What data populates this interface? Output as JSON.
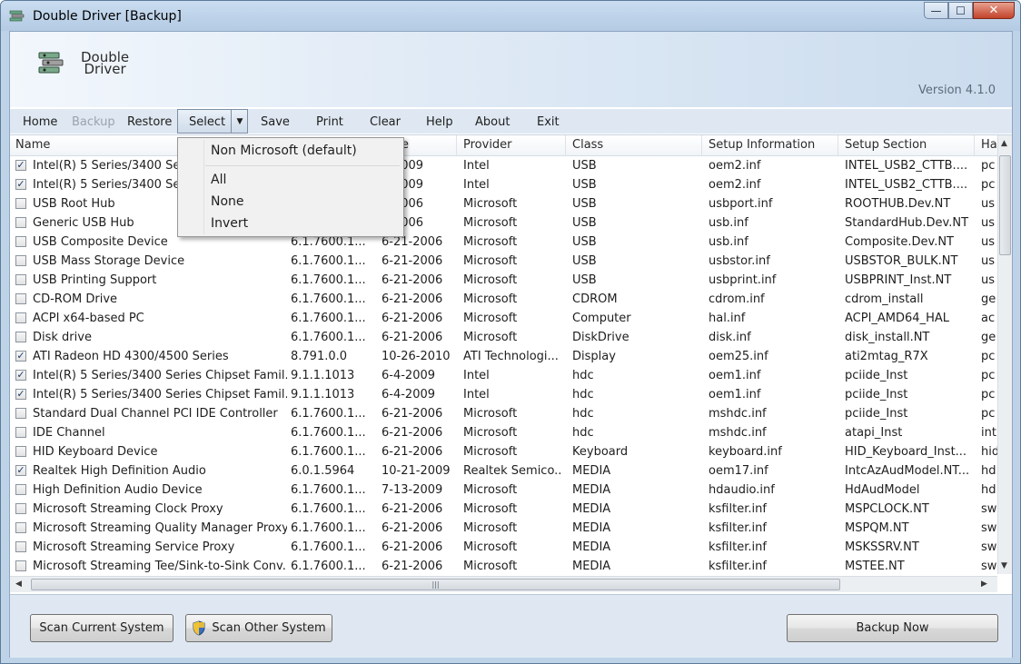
{
  "window": {
    "title": "Double Driver [Backup]",
    "minimize": "—",
    "maximize": "☐",
    "close": "✕"
  },
  "banner": {
    "logo_line1": "Double",
    "logo_line2": "Driver",
    "version": "Version 4.1.0"
  },
  "menu": {
    "home": "Home",
    "backup": "Backup",
    "restore": "Restore",
    "select": "Select",
    "save": "Save",
    "print": "Print",
    "clear": "Clear",
    "help": "Help",
    "about": "About",
    "exit": "Exit"
  },
  "select_dropdown": [
    "Non Microsoft (default)",
    "All",
    "None",
    "Invert"
  ],
  "columns": [
    "Name",
    "e",
    "Provider",
    "Class",
    "Setup Information",
    "Setup Section",
    "Ha"
  ],
  "rows": [
    {
      "checked": true,
      "name": "Intel(R) 5 Series/3400 Seri",
      "version": "",
      "date": "0-2009",
      "provider": "Intel",
      "class": "USB",
      "inf": "oem2.inf",
      "section": "INTEL_USB2_CTTB....",
      "hw": "pc"
    },
    {
      "checked": true,
      "name": "Intel(R) 5 Series/3400 Seri",
      "version": "",
      "date": "0-2009",
      "provider": "Intel",
      "class": "USB",
      "inf": "oem2.inf",
      "section": "INTEL_USB2_CTTB....",
      "hw": "pc"
    },
    {
      "checked": false,
      "name": "USB Root Hub",
      "version": "",
      "date": "1-2006",
      "provider": "Microsoft",
      "class": "USB",
      "inf": "usbport.inf",
      "section": "ROOTHUB.Dev.NT",
      "hw": "us"
    },
    {
      "checked": false,
      "name": "Generic USB Hub",
      "version": "",
      "date": "1-2006",
      "provider": "Microsoft",
      "class": "USB",
      "inf": "usb.inf",
      "section": "StandardHub.Dev.NT",
      "hw": "us"
    },
    {
      "checked": false,
      "name": "USB Composite Device",
      "version": "6.1.7600.1...",
      "date": "6-21-2006",
      "provider": "Microsoft",
      "class": "USB",
      "inf": "usb.inf",
      "section": "Composite.Dev.NT",
      "hw": "us"
    },
    {
      "checked": false,
      "name": "USB Mass Storage Device",
      "version": "6.1.7600.1...",
      "date": "6-21-2006",
      "provider": "Microsoft",
      "class": "USB",
      "inf": "usbstor.inf",
      "section": "USBSTOR_BULK.NT",
      "hw": "us"
    },
    {
      "checked": false,
      "name": "USB Printing Support",
      "version": "6.1.7600.1...",
      "date": "6-21-2006",
      "provider": "Microsoft",
      "class": "USB",
      "inf": "usbprint.inf",
      "section": "USBPRINT_Inst.NT",
      "hw": "us"
    },
    {
      "checked": false,
      "name": "CD-ROM Drive",
      "version": "6.1.7600.1...",
      "date": "6-21-2006",
      "provider": "Microsoft",
      "class": "CDROM",
      "inf": "cdrom.inf",
      "section": "cdrom_install",
      "hw": "ge"
    },
    {
      "checked": false,
      "name": "ACPI x64-based PC",
      "version": "6.1.7600.1...",
      "date": "6-21-2006",
      "provider": "Microsoft",
      "class": "Computer",
      "inf": "hal.inf",
      "section": "ACPI_AMD64_HAL",
      "hw": "ac"
    },
    {
      "checked": false,
      "name": "Disk drive",
      "version": "6.1.7600.1...",
      "date": "6-21-2006",
      "provider": "Microsoft",
      "class": "DiskDrive",
      "inf": "disk.inf",
      "section": "disk_install.NT",
      "hw": "ge"
    },
    {
      "checked": true,
      "name": "ATI Radeon HD 4300/4500 Series",
      "version": "8.791.0.0",
      "date": "10-26-2010",
      "provider": "ATI Technologi...",
      "class": "Display",
      "inf": "oem25.inf",
      "section": "ati2mtag_R7X",
      "hw": "pc"
    },
    {
      "checked": true,
      "name": "Intel(R) 5 Series/3400 Series Chipset Famil...",
      "version": "9.1.1.1013",
      "date": "6-4-2009",
      "provider": "Intel",
      "class": "hdc",
      "inf": "oem1.inf",
      "section": "pciide_Inst",
      "hw": "pc"
    },
    {
      "checked": true,
      "name": "Intel(R) 5 Series/3400 Series Chipset Famil...",
      "version": "9.1.1.1013",
      "date": "6-4-2009",
      "provider": "Intel",
      "class": "hdc",
      "inf": "oem1.inf",
      "section": "pciide_Inst",
      "hw": "pc"
    },
    {
      "checked": false,
      "name": "Standard Dual Channel PCI IDE Controller",
      "version": "6.1.7600.1...",
      "date": "6-21-2006",
      "provider": "Microsoft",
      "class": "hdc",
      "inf": "mshdc.inf",
      "section": "pciide_Inst",
      "hw": "pc"
    },
    {
      "checked": false,
      "name": "IDE Channel",
      "version": "6.1.7600.1...",
      "date": "6-21-2006",
      "provider": "Microsoft",
      "class": "hdc",
      "inf": "mshdc.inf",
      "section": "atapi_Inst",
      "hw": "int"
    },
    {
      "checked": false,
      "name": "HID Keyboard Device",
      "version": "6.1.7600.1...",
      "date": "6-21-2006",
      "provider": "Microsoft",
      "class": "Keyboard",
      "inf": "keyboard.inf",
      "section": "HID_Keyboard_Inst...",
      "hw": "hid"
    },
    {
      "checked": true,
      "name": "Realtek High Definition Audio",
      "version": "6.0.1.5964",
      "date": "10-21-2009",
      "provider": "Realtek Semico...",
      "class": "MEDIA",
      "inf": "oem17.inf",
      "section": "IntcAzAudModel.NT...",
      "hw": "hd"
    },
    {
      "checked": false,
      "name": "High Definition Audio Device",
      "version": "6.1.7600.1...",
      "date": "7-13-2009",
      "provider": "Microsoft",
      "class": "MEDIA",
      "inf": "hdaudio.inf",
      "section": "HdAudModel",
      "hw": "hd"
    },
    {
      "checked": false,
      "name": "Microsoft Streaming Clock Proxy",
      "version": "6.1.7600.1...",
      "date": "6-21-2006",
      "provider": "Microsoft",
      "class": "MEDIA",
      "inf": "ksfilter.inf",
      "section": "MSPCLOCK.NT",
      "hw": "sw"
    },
    {
      "checked": false,
      "name": "Microsoft Streaming Quality Manager Proxy",
      "version": "6.1.7600.1...",
      "date": "6-21-2006",
      "provider": "Microsoft",
      "class": "MEDIA",
      "inf": "ksfilter.inf",
      "section": "MSPQM.NT",
      "hw": "sw"
    },
    {
      "checked": false,
      "name": "Microsoft Streaming Service Proxy",
      "version": "6.1.7600.1...",
      "date": "6-21-2006",
      "provider": "Microsoft",
      "class": "MEDIA",
      "inf": "ksfilter.inf",
      "section": "MSKSSRV.NT",
      "hw": "sw"
    },
    {
      "checked": false,
      "name": "Microsoft Streaming Tee/Sink-to-Sink Conv...",
      "version": "6.1.7600.1...",
      "date": "6-21-2006",
      "provider": "Microsoft",
      "class": "MEDIA",
      "inf": "ksfilter.inf",
      "section": "MSTEE.NT",
      "hw": "sw"
    }
  ],
  "buttons": {
    "scan_current": "Scan Current System",
    "scan_other": "Scan Other System",
    "backup_now": "Backup Now"
  },
  "colors": {
    "accent": "#bfd3e8",
    "menu_bg": "#dfe8f2",
    "close_button": "#c2432a"
  }
}
